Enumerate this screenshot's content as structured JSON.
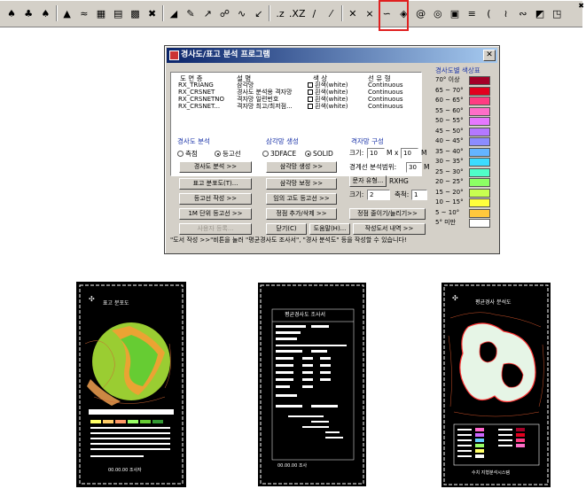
{
  "highlight_color": "#e02020",
  "toolbar": {
    "buttons": [
      {
        "icon": "tree-icon-1",
        "glyph": "♠"
      },
      {
        "icon": "tree-icon-2",
        "glyph": "♣"
      },
      {
        "icon": "tree-icon-3",
        "glyph": "♠"
      },
      {
        "icon": "terrain-icon",
        "glyph": "▲"
      },
      {
        "icon": "wave-icon",
        "glyph": "≈"
      },
      {
        "icon": "grid-icon",
        "glyph": "▦"
      },
      {
        "icon": "table-icon",
        "glyph": "▤"
      },
      {
        "icon": "grid-chart-icon",
        "glyph": "▩"
      },
      {
        "icon": "cross-icon",
        "glyph": "✖"
      },
      {
        "icon": "chart-icon",
        "glyph": "◢"
      },
      {
        "icon": "pencil-icon",
        "glyph": "✎"
      },
      {
        "icon": "edit-chart-icon",
        "glyph": "↗"
      },
      {
        "icon": "node-line-icon",
        "glyph": "☍"
      },
      {
        "icon": "curve-icon",
        "glyph": "∿"
      },
      {
        "icon": "arrow-line-icon",
        "glyph": "↙"
      },
      {
        "icon": "z-text-icon",
        "glyph": ".z"
      },
      {
        "icon": "xz-text-icon",
        "glyph": ".XZ"
      },
      {
        "icon": "line-tool-icon",
        "glyph": "∕"
      },
      {
        "icon": "slash-tool-icon",
        "glyph": "⁄"
      },
      {
        "icon": "cross-tool-icon",
        "glyph": "✕"
      },
      {
        "icon": "branch-icon",
        "glyph": "⨯"
      },
      {
        "icon": "wave-line-icon",
        "glyph": "∽"
      },
      {
        "icon": "diamond-icon",
        "glyph": "◈"
      },
      {
        "icon": "spiral-icon",
        "glyph": "@"
      },
      {
        "icon": "target-icon",
        "glyph": "◎"
      },
      {
        "icon": "square-target-icon",
        "glyph": "▣"
      },
      {
        "icon": "contour-icon",
        "glyph": "≡"
      },
      {
        "icon": "arc-icon",
        "glyph": "("
      },
      {
        "icon": "waves-icon",
        "glyph": "≀"
      },
      {
        "icon": "squiggle-icon",
        "glyph": "∾"
      },
      {
        "icon": "box-slash-icon",
        "glyph": "◩"
      },
      {
        "icon": "box-2-icon",
        "glyph": "◳"
      }
    ],
    "close_glyph": "✖"
  },
  "dialog": {
    "title": "경사도/표고 분석 프로그램",
    "close_glyph": "✕",
    "layer_table": {
      "columns": [
        "도 면 층",
        "설 명",
        "색 상",
        "선 유 형"
      ],
      "rows": [
        {
          "layer": "RX_TRIANG",
          "desc": "삼각망",
          "color": "흰색(white)",
          "linetype": "Continuous"
        },
        {
          "layer": "RX_CRSNET",
          "desc": "경사도 분석용 격자망",
          "color": "흰색(white)",
          "linetype": "Continuous"
        },
        {
          "layer": "RX_CRSNETNO",
          "desc": "격자망 일련번호",
          "color": "흰색(white)",
          "linetype": "Continuous"
        },
        {
          "layer": "RX_CRSNET...",
          "desc": "격자망 최고/최저점...",
          "color": "흰색(white)",
          "linetype": "Continuous"
        }
      ]
    },
    "slope_analysis": {
      "title": "경사도 분석",
      "radio_survey": "측점",
      "radio_contour": "등고선",
      "btn_slope_analysis": "경사도 분석 >>",
      "btn_elevation_map": "표고 분포도(T)...",
      "btn_contour_create": "등고선 작성 >>",
      "btn_contour_1m": "1M 단위 등고선 >>",
      "btn_user_register": "사용자 등록..."
    },
    "triangulation": {
      "title": "삼각망 생성",
      "radio_3dface": "3DFACE",
      "radio_solid": "SOLID",
      "btn_create": "삼각망 생성 >>",
      "btn_correct": "삼각망 보정 >>",
      "btn_arbitrary": "임의 고도 등고선 >>",
      "btn_vertex": "정점 추가/삭제 >>"
    },
    "grid": {
      "title": "격자망 구성",
      "size_label": "크기:",
      "size_x": "10",
      "size_unit_x": "M",
      "times": "x",
      "size_y": "10",
      "size_unit_y": "M",
      "range_label": "경계선 분석범위:",
      "range_value": "30",
      "range_unit": "M",
      "btn_text_style": "문자 유형...",
      "text_style_value": "RXHG",
      "text_size_label": "크기:",
      "text_size_value": "2",
      "scale_label": "축척:",
      "scale_value": "1",
      "btn_zoom": "정점 줄이기/늘리기>>"
    },
    "bottom": {
      "btn_close": "닫기(C)",
      "btn_help": "도움말(H)...",
      "btn_report": "작성도서 내역 >>"
    },
    "status_text": "\"도서 작성 >>\"비튼을 눌러 \"평균경사도 조사서\", \"경사 분석도\" 등을 작성할 수 있습니다!",
    "legend": {
      "title": "경사도별 색상표",
      "items": [
        {
          "label": "70° 이상",
          "color": "#a40028"
        },
        {
          "label": "65 ~ 70°",
          "color": "#e2001e"
        },
        {
          "label": "60 ~ 65°",
          "color": "#ff3c82"
        },
        {
          "label": "55 ~ 60°",
          "color": "#ff6ec8"
        },
        {
          "label": "50 ~ 55°",
          "color": "#e678ff"
        },
        {
          "label": "45 ~ 50°",
          "color": "#b478ff"
        },
        {
          "label": "40 ~ 45°",
          "color": "#8c8cff"
        },
        {
          "label": "35 ~ 40°",
          "color": "#64b4ff"
        },
        {
          "label": "30 ~ 35°",
          "color": "#3cdcff"
        },
        {
          "label": "25 ~ 30°",
          "color": "#50ffc8"
        },
        {
          "label": "20 ~ 25°",
          "color": "#8cff64"
        },
        {
          "label": "15 ~ 20°",
          "color": "#c8ff50"
        },
        {
          "label": "10 ~ 15°",
          "color": "#ffff3c"
        },
        {
          "label": "5 ~ 10°",
          "color": "#ffc83c"
        },
        {
          "label": "5° 미만",
          "color": "#ffffff"
        }
      ]
    }
  },
  "sheets": {
    "left": {
      "title": "표고 분포도",
      "footer": "00.00.00 조사자"
    },
    "middle": {
      "title": "평균경사도 조사서",
      "footer": "00.00.00 조사"
    },
    "right": {
      "title": "평균경사 분석도",
      "footer": "수치 지형분석시스템"
    }
  }
}
